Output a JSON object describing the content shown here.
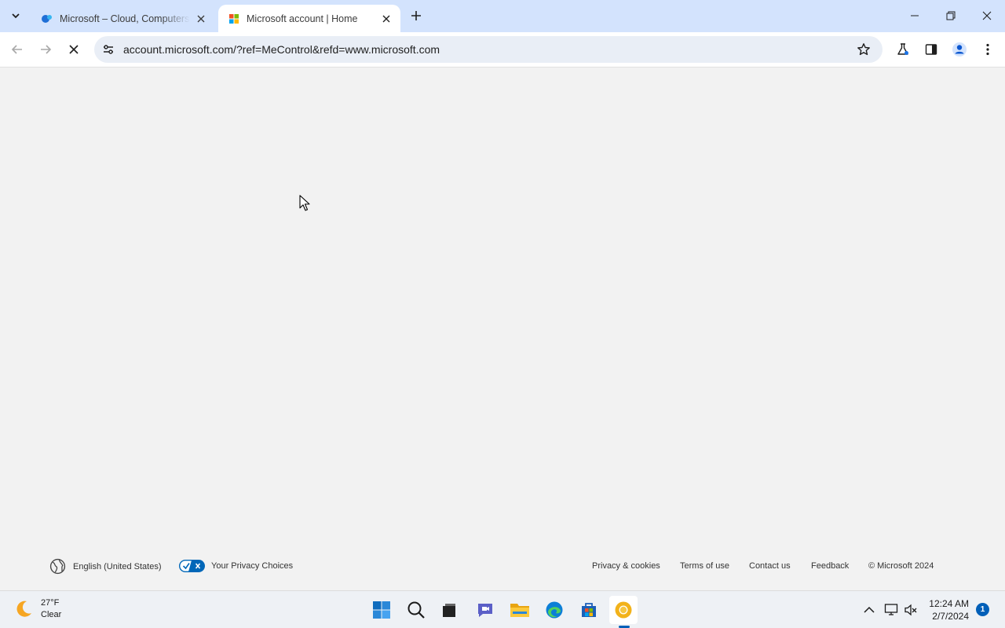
{
  "browser": {
    "tabs": [
      {
        "title": "Microsoft – Cloud, Computers, Apps & Gaming",
        "active": false,
        "favicon": "microsoft-edge-favicon"
      },
      {
        "title": "Microsoft account | Home",
        "active": true,
        "favicon": "microsoft-logo-favicon"
      }
    ],
    "address_bar": {
      "url": "account.microsoft.com/?ref=MeControl&refd=www.microsoft.com"
    },
    "loading": true
  },
  "footer": {
    "language": "English (United States)",
    "privacy_choices": "Your Privacy Choices",
    "links": [
      "Privacy & cookies",
      "Terms of use",
      "Contact us",
      "Feedback"
    ],
    "copyright": "© Microsoft 2024"
  },
  "taskbar": {
    "weather": {
      "temp": "27°F",
      "condition": "Clear"
    },
    "clock": {
      "time": "12:24 AM",
      "date": "2/7/2024"
    },
    "notifications": "1",
    "apps": [
      "start-icon",
      "search-icon",
      "task-view-icon",
      "teams-chat-icon",
      "file-explorer-icon",
      "edge-icon",
      "store-icon",
      "chrome-canary-icon"
    ]
  },
  "colors": {
    "tabstrip": "#d3e3fd",
    "page_bg": "#f2f2f2",
    "accent": "#005fb8"
  }
}
